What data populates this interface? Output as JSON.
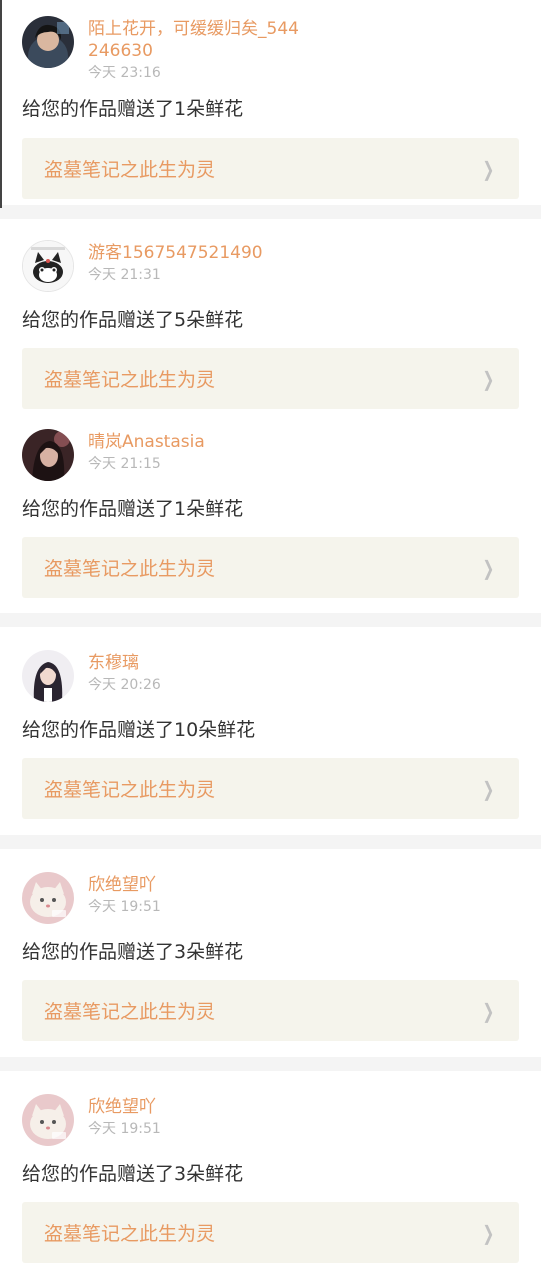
{
  "notifications": [
    {
      "username": "陌上花开，可缓缓归矣_544246630",
      "time": "今天 23:16",
      "message": "给您的作品赠送了1朵鲜花",
      "work_title": "盗墓笔记之此生为灵",
      "avatar": {
        "icon": "avatar-boy-dark-hair",
        "bg": "#2a2f3a",
        "accent": "#7aa6c9"
      }
    },
    {
      "username": "游客1567547521490",
      "time": "今天 21:31",
      "message": "给您的作品赠送了5朵鲜花",
      "work_title": "盗墓笔记之此生为灵",
      "avatar": {
        "icon": "avatar-cat-cartoon",
        "bg": "#f3f3f3",
        "accent": "#222222"
      }
    },
    {
      "username": "晴岚Anastasia",
      "time": "今天 21:15",
      "message": "给您的作品赠送了1朵鲜花",
      "work_title": "盗墓笔记之此生为灵",
      "avatar": {
        "icon": "avatar-girl-dark",
        "bg": "#3a2426",
        "accent": "#b66a6f"
      }
    },
    {
      "username": "东穆璃",
      "time": "今天 20:26",
      "message": "给您的作品赠送了10朵鲜花",
      "work_title": "盗墓笔记之此生为灵",
      "avatar": {
        "icon": "avatar-girl-long-hair",
        "bg": "#f0eef2",
        "accent": "#2a2430"
      }
    },
    {
      "username": "欣绝望吖",
      "time": "今天 19:51",
      "message": "给您的作品赠送了3朵鲜花",
      "work_title": "盗墓笔记之此生为灵",
      "avatar": {
        "icon": "avatar-white-cat",
        "bg": "#e9c9cb",
        "accent": "#f6efe9"
      }
    },
    {
      "username": "欣绝望吖",
      "time": "今天 19:51",
      "message": "给您的作品赠送了3朵鲜花",
      "work_title": "盗墓笔记之此生为灵",
      "avatar": {
        "icon": "avatar-white-cat",
        "bg": "#e9c9cb",
        "accent": "#f6efe9"
      }
    }
  ],
  "ui": {
    "chevron_icon": "chevron-right-icon",
    "accent_color": "#e89a62",
    "time_color": "#b8b8b8",
    "card_bg": "#f5f4ec",
    "divider_color": "#f4f4f4"
  }
}
